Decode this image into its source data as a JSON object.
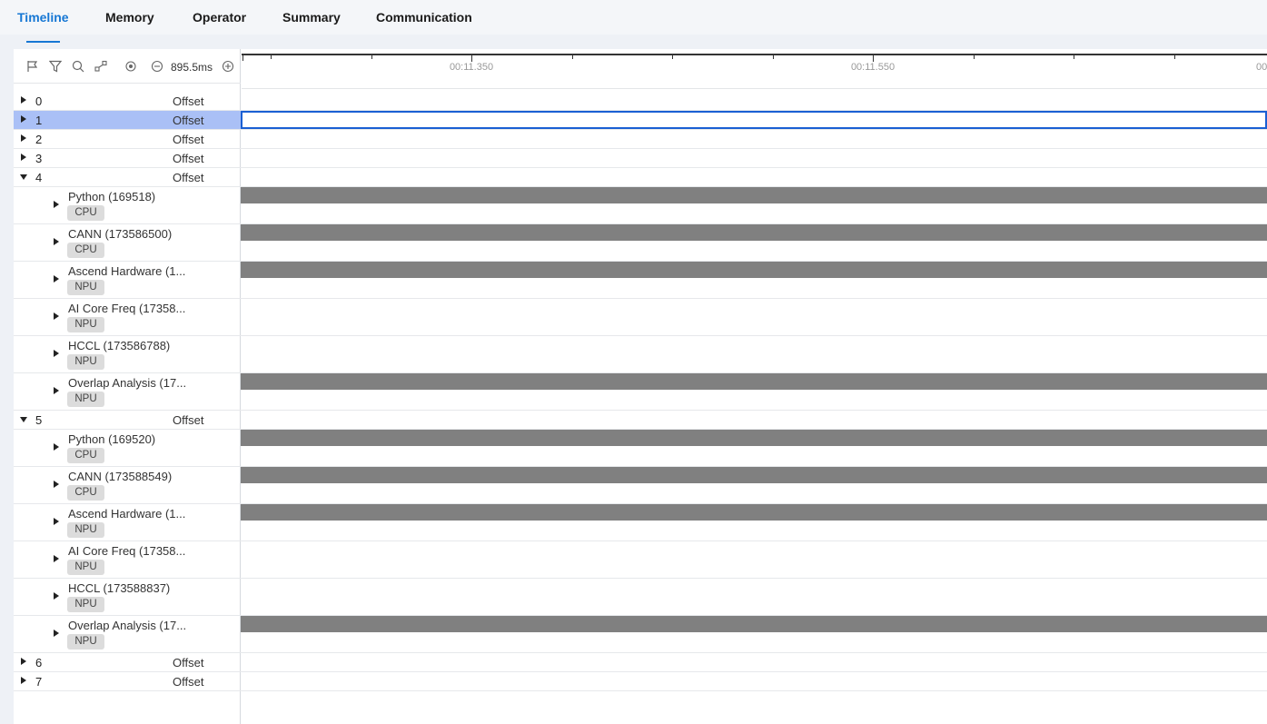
{
  "tabs": [
    {
      "label": "Timeline",
      "active": true
    },
    {
      "label": "Memory",
      "active": false
    },
    {
      "label": "Operator",
      "active": false
    },
    {
      "label": "Summary",
      "active": false
    },
    {
      "label": "Communication",
      "active": false
    }
  ],
  "toolbar": {
    "icons": [
      "flag-icon",
      "filter-icon",
      "search-icon",
      "link-icon",
      "reset-icon",
      "zoom-out-icon",
      "zoom-in-icon"
    ],
    "zoom_level": "895.5ms"
  },
  "ruler": {
    "labels": [
      "00:11.350",
      "00:11.550",
      "00:1"
    ]
  },
  "colors": {
    "accent": "#1677d4",
    "selected_row": "#aac0f6",
    "bar": "#808080",
    "selection_border": "#1a5fd3"
  },
  "rows": [
    {
      "kind": "rank",
      "label": "0",
      "offset": "Offset",
      "expanded": false
    },
    {
      "kind": "rank",
      "label": "1",
      "offset": "Offset",
      "expanded": false,
      "selected": true
    },
    {
      "kind": "rank",
      "label": "2",
      "offset": "Offset",
      "expanded": false
    },
    {
      "kind": "rank",
      "label": "3",
      "offset": "Offset",
      "expanded": false
    },
    {
      "kind": "rank",
      "label": "4",
      "offset": "Offset",
      "expanded": true
    },
    {
      "kind": "proc",
      "name": "Python (169518)",
      "badge": "CPU",
      "bar": true
    },
    {
      "kind": "proc",
      "name": "CANN (173586500)",
      "badge": "CPU",
      "bar": true
    },
    {
      "kind": "proc",
      "name": "Ascend Hardware (1...",
      "badge": "NPU",
      "bar": true
    },
    {
      "kind": "proc",
      "name": "AI Core Freq (17358...",
      "badge": "NPU",
      "bar": false
    },
    {
      "kind": "proc",
      "name": "HCCL (173586788)",
      "badge": "NPU",
      "bar": false
    },
    {
      "kind": "proc",
      "name": "Overlap Analysis (17...",
      "badge": "NPU",
      "bar": true
    },
    {
      "kind": "rank",
      "label": "5",
      "offset": "Offset",
      "expanded": true
    },
    {
      "kind": "proc",
      "name": "Python (169520)",
      "badge": "CPU",
      "bar": true
    },
    {
      "kind": "proc",
      "name": "CANN (173588549)",
      "badge": "CPU",
      "bar": true
    },
    {
      "kind": "proc",
      "name": "Ascend Hardware (1...",
      "badge": "NPU",
      "bar": true
    },
    {
      "kind": "proc",
      "name": "AI Core Freq (17358...",
      "badge": "NPU",
      "bar": false
    },
    {
      "kind": "proc",
      "name": "HCCL (173588837)",
      "badge": "NPU",
      "bar": false
    },
    {
      "kind": "proc",
      "name": "Overlap Analysis (17...",
      "badge": "NPU",
      "bar": true
    },
    {
      "kind": "rank",
      "label": "6",
      "offset": "Offset",
      "expanded": false
    },
    {
      "kind": "rank",
      "label": "7",
      "offset": "Offset",
      "expanded": false
    }
  ]
}
